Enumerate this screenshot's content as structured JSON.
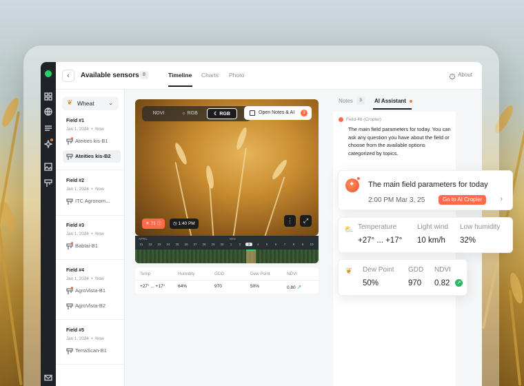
{
  "colors": {
    "accent_orange": "#ff6b4a",
    "sidebar_dark": "#1f2328",
    "trend_green": "#2bb866",
    "brand_green": "#2bd06a"
  },
  "sidebar_rail": {
    "icons": [
      "grid-icon",
      "globe-icon",
      "layers-icon",
      "sparkle-icon",
      "image-icon",
      "sensor-icon",
      "mail-icon"
    ]
  },
  "header": {
    "title": "Available sensors",
    "count": "8",
    "tabs": [
      "Timeline",
      "Charts",
      "Photo"
    ],
    "active_tab": "Timeline",
    "about": "About"
  },
  "crop_selector": {
    "value": "Wheat"
  },
  "fields": [
    {
      "name": "Field #1",
      "date": "Jan 1, 2024",
      "sep": "•",
      "until": "Now",
      "sensors": [
        {
          "label": "Ateities kis-B1",
          "active": false
        },
        {
          "label": "Ateities kis-B2",
          "active": true
        }
      ]
    },
    {
      "name": "Field #2",
      "date": "Jan 1, 2024",
      "sep": "•",
      "until": "Now",
      "sensors": [
        {
          "label": "ITC Agronom...",
          "active": false
        }
      ]
    },
    {
      "name": "Field #3",
      "date": "Jan 1, 2024",
      "sep": "•",
      "until": "Now",
      "sensors": [
        {
          "label": "Babtai-B1",
          "active": false
        }
      ]
    },
    {
      "name": "Field #4",
      "date": "Jan 1, 2024",
      "sep": "•",
      "until": "Now",
      "sensors": [
        {
          "label": "AgroVista-B1",
          "active": false
        },
        {
          "label": "AgroVista-B2",
          "active": false
        }
      ]
    },
    {
      "name": "Field #5",
      "date": "Jan 1, 2024",
      "sep": "•",
      "until": "Now",
      "sensors": [
        {
          "label": "TerraScan-B1",
          "active": false
        }
      ]
    }
  ],
  "photo": {
    "modes": [
      "NDVI",
      "RGB",
      "RGB"
    ],
    "active_mode": "RGB",
    "open_notes": "Open Notes & AI",
    "notes_badge": "3",
    "alert_chip": "71",
    "time_chip": "1:40 PM"
  },
  "timeline": {
    "months": [
      "APRIL",
      "MAY"
    ],
    "days": [
      "21",
      "22",
      "23",
      "24",
      "25",
      "26",
      "27",
      "28",
      "29",
      "30",
      "1",
      "2",
      "3",
      "4",
      "5",
      "6",
      "7",
      "8",
      "9",
      "10",
      "11"
    ],
    "selected_day": "3"
  },
  "stats_table": {
    "headers": [
      "Temp",
      "Humidity",
      "GDD",
      "Dew Point",
      "NDVI"
    ],
    "values": [
      "+27° ... +17°",
      "64%",
      "970",
      "50%",
      "0.80"
    ]
  },
  "right_panel": {
    "tabs": {
      "notes": "Notes",
      "notes_count": "3",
      "ai": "AI Assistant"
    },
    "message_source": "Field-46 (Cropler)",
    "message": "The main field parameters for today. You can ask any question you have about the field or choose from the available options categorized by topics."
  },
  "card_main": {
    "title": "The main field parameters for today",
    "time": "2:00 PM Mar 3, 25",
    "button": "Go to AI Cropler"
  },
  "card_weather": {
    "labels": [
      "Temperature",
      "Light wind",
      "Low humidity"
    ],
    "values": [
      "+27° ... +17°",
      "10 km/h",
      "32%"
    ]
  },
  "card_crop": {
    "labels": [
      "Dew Point",
      "GDD",
      "NDVI"
    ],
    "values": [
      "50%",
      "970",
      "0.82"
    ]
  }
}
